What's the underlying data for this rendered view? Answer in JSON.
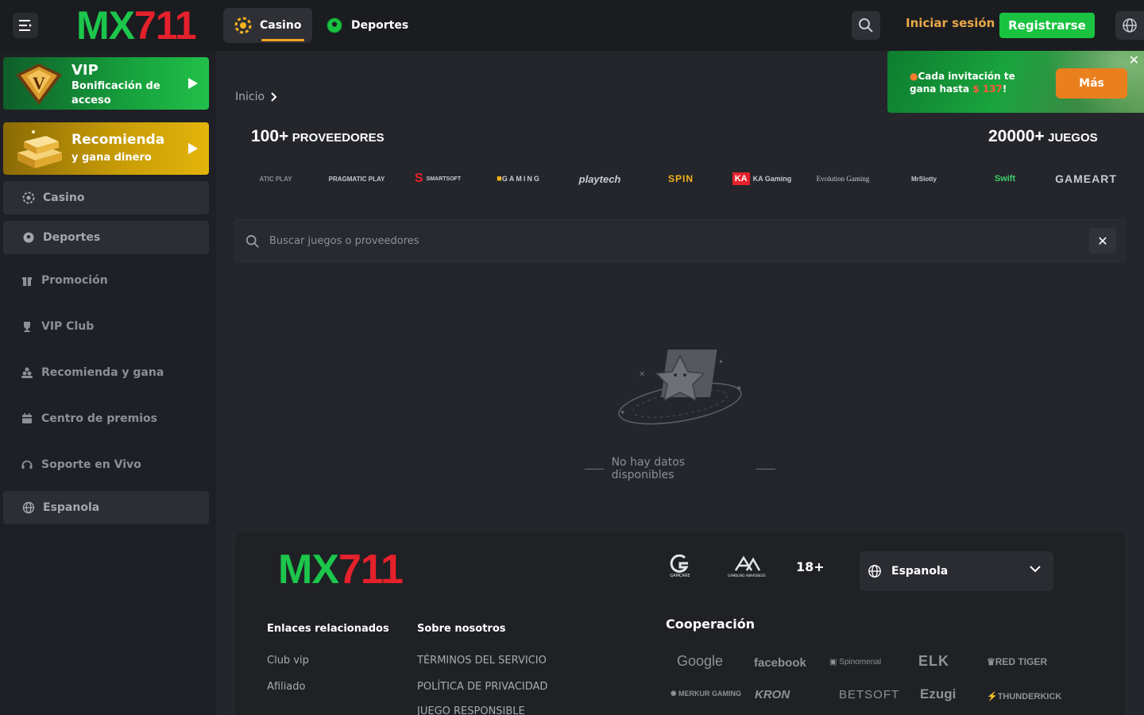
{
  "header": {
    "logo_mx": "MX",
    "logo_num": "711",
    "tabs": [
      {
        "label": "Casino",
        "icon": "casino-chip-icon",
        "active": true
      },
      {
        "label": "Deportes",
        "icon": "soccer-ball-icon",
        "active": false
      }
    ],
    "login_label": "Iniciar sesión",
    "register_label": "Registrarse"
  },
  "sidebar": {
    "vip_promo": {
      "title": "VIP",
      "subtitle": "Bonificación de acceso"
    },
    "referral_promo": {
      "title": "Recomienda",
      "subtitle": "y gana dinero"
    },
    "buttons": [
      {
        "label": "Casino",
        "icon": "casino-chip-icon"
      },
      {
        "label": "Deportes",
        "icon": "soccer-ball-icon"
      }
    ],
    "items": [
      {
        "label": "Promoción",
        "icon": "gift-icon"
      },
      {
        "label": "VIP Club",
        "icon": "trophy-icon"
      },
      {
        "label": "Recomienda y gana",
        "icon": "users-icon"
      },
      {
        "label": "Centro de premios",
        "icon": "calendar-icon"
      },
      {
        "label": "Soporte en Vivo",
        "icon": "headset-icon"
      }
    ],
    "language_button": {
      "label": "Espanola",
      "icon": "globe-icon"
    }
  },
  "breadcrumb": {
    "home": "Inicio"
  },
  "invite_banner": {
    "text_before": "Cada invitación te gana hasta ",
    "amount": "$ 137",
    "text_after": "!",
    "button_label": "Más",
    "close_label": "✕"
  },
  "providers_heading": {
    "count": "100+",
    "label": "PROVEEDORES"
  },
  "games_heading": {
    "count": "20000+",
    "label": "JUEGOS"
  },
  "providers": [
    "ATIC PLAY",
    "PRAGMATIC PLAY",
    "SMARTSOFT",
    "GAMING",
    "playtech",
    "SPIN",
    "KA Gaming",
    "Evolution Gaming",
    "MrSlotty",
    "Swift",
    "GAMEART"
  ],
  "search": {
    "placeholder": "Buscar juegos o proveedores",
    "clear_label": "✕"
  },
  "empty_state": {
    "text": "No hay datos disponibles"
  },
  "footer": {
    "logo_mx": "MX",
    "logo_num": "711",
    "badges": [
      "GAMCARE",
      "GAMBLING AWARENESS"
    ],
    "age": "18+",
    "language": "Espanola",
    "col1": {
      "title": "Enlaces relacionados",
      "links": [
        "Club vip",
        "Afiliado"
      ]
    },
    "col2": {
      "title": "Sobre nosotros",
      "links": [
        "TÉRMINOS DEL SERVICIO",
        "POLÍTICA DE PRIVACIDAD",
        "JUEGO RESPONSIBLE"
      ]
    },
    "coop_title": "Cooperación",
    "partners": [
      "Google",
      "facebook",
      "Spinomenal",
      "ELK",
      "RED TIGER",
      "MERKUR GAMING",
      "KRON",
      "BETSOFT",
      "Ezugi",
      "THUNDERKICK"
    ]
  },
  "colors": {
    "accent_green": "#19c23f",
    "accent_orange": "#ea7f1d",
    "login_gold": "#e9a84a",
    "logo_red": "#e5212b"
  }
}
